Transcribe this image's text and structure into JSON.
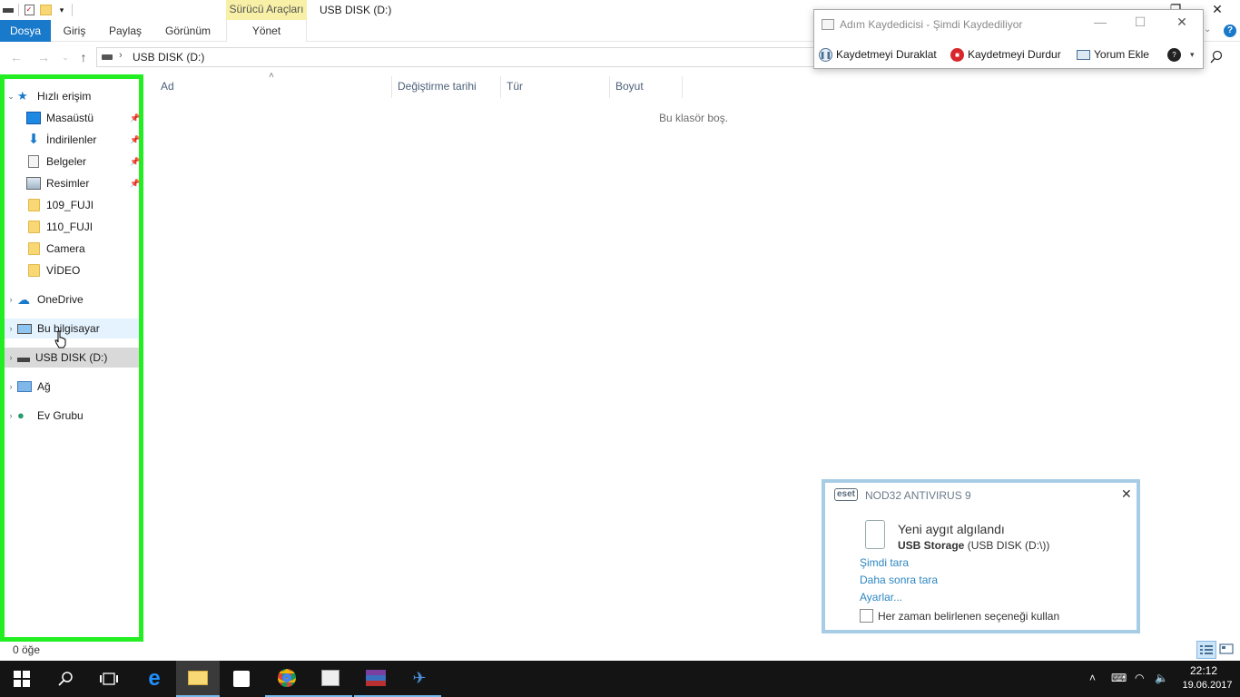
{
  "window": {
    "title": "USB DISK (D:)",
    "context_tab": "Sürücü Araçları"
  },
  "ribbon": {
    "tabs": [
      "Dosya",
      "Giriş",
      "Paylaş",
      "Görünüm",
      "Yönet"
    ]
  },
  "address": {
    "path": "USB DISK (D:)"
  },
  "nav": {
    "quick_access": "Hızlı erişim",
    "items": [
      {
        "label": "Masaüstü",
        "icon": "desktop-icon",
        "pinned": true
      },
      {
        "label": "İndirilenler",
        "icon": "downloads-icon",
        "pinned": true
      },
      {
        "label": "Belgeler",
        "icon": "documents-icon",
        "pinned": true
      },
      {
        "label": "Resimler",
        "icon": "pictures-icon",
        "pinned": true
      },
      {
        "label": "109_FUJI",
        "icon": "folder-icon",
        "pinned": false
      },
      {
        "label": "110_FUJI",
        "icon": "folder-icon",
        "pinned": false
      },
      {
        "label": "Camera",
        "icon": "folder-icon",
        "pinned": false
      },
      {
        "label": "VİDEO",
        "icon": "folder-icon",
        "pinned": false
      }
    ],
    "onedrive": "OneDrive",
    "this_pc": "Bu bilgisayar",
    "usb_disk": "USB DISK (D:)",
    "network": "Ağ",
    "homegroup": "Ev Grubu"
  },
  "columns": [
    "Ad",
    "Değiştirme tarihi",
    "Tür",
    "Boyut"
  ],
  "empty_message": "Bu klasör boş.",
  "status": {
    "item_count": "0 öğe"
  },
  "steps_recorder": {
    "title": "Adım Kaydedicisi - Şimdi Kaydediliyor",
    "pause": "Kaydetmeyi Duraklat",
    "stop": "Kaydetmeyi Durdur",
    "comment": "Yorum Ekle"
  },
  "eset": {
    "logo": "eset",
    "title": "NOD32 ANTIVIRUS 9",
    "heading": "Yeni aygıt algılandı",
    "device_bold": "USB Storage",
    "device_rest": " (USB DISK (D:\\))",
    "link_scan_now": "Şimdi tara",
    "link_scan_later": "Daha sonra tara",
    "link_settings": "Ayarlar...",
    "checkbox_label": "Her zaman belirlenen seçeneği kullan"
  },
  "taskbar": {
    "time": "22:12",
    "date": "19.06.2017"
  },
  "colors": {
    "accent": "#1979ca",
    "highlight_border": "#22ee22",
    "context_tab": "#f7f0a6",
    "taskbar": "#141414",
    "eset_border": "#a7cde6"
  }
}
